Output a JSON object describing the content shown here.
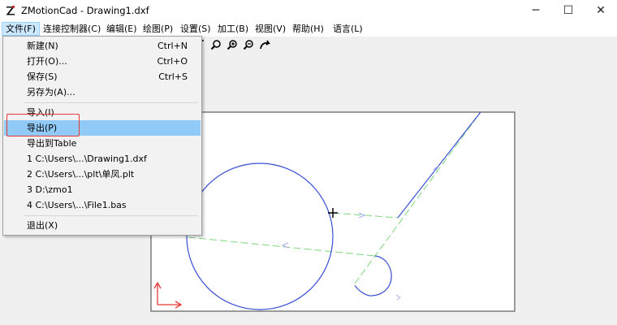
{
  "window": {
    "title": "ZMotionCad - Drawing1.dxf",
    "minimize_label": "─",
    "maximize_label": "☐",
    "close_label": "✕"
  },
  "menubar": {
    "items": [
      "文件(F)",
      "连接控制器(C)",
      "编辑(E)",
      "绘图(P)",
      "设置(S)",
      "加工(B)",
      "视图(V)",
      "帮助(H)",
      "语言(L)"
    ]
  },
  "file_menu": {
    "new": {
      "label": "新建(N)",
      "shortcut": "Ctrl+N"
    },
    "open": {
      "label": "打开(O)...",
      "shortcut": "Ctrl+O"
    },
    "save": {
      "label": "保存(S)",
      "shortcut": "Ctrl+S"
    },
    "save_as": {
      "label": "另存为(A)..."
    },
    "import": {
      "label": "导入(I)"
    },
    "export": {
      "label": "导出(P)"
    },
    "export_table": {
      "label": "导出到Table"
    },
    "recent": [
      "1 C:\\Users\\...\\Drawing1.dxf",
      "2 C:\\Users\\...\\plt\\单凤.plt",
      "3 D:\\zmo1",
      "4 C:\\Users\\...\\File1.bas"
    ],
    "exit": {
      "label": "退出(X)"
    }
  },
  "colors": {
    "accent_highlight": "#91c9f7",
    "annotation_box": "#e53935",
    "geometry_blue": "#3a4fd6",
    "path_green": "#7ed67e",
    "axis_red": "#e53935"
  },
  "toolbar": {
    "icons": [
      "zoom-extents-icon",
      "zoom-in-icon",
      "zoom-out-icon",
      "pan-icon"
    ]
  }
}
